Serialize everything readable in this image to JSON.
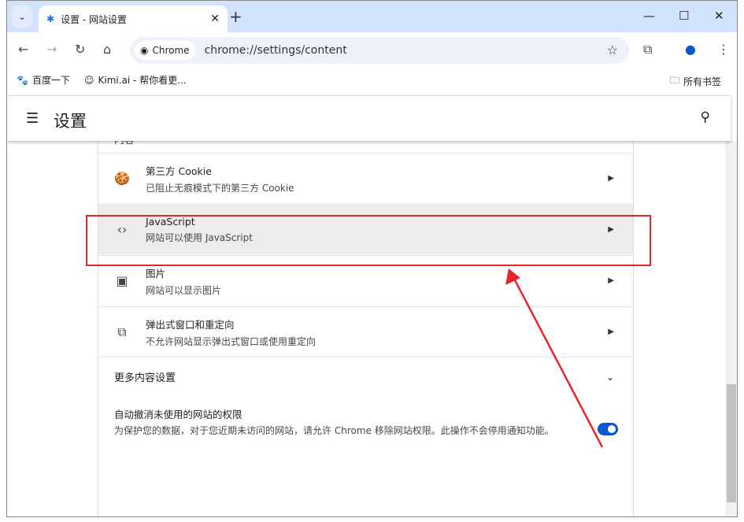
{
  "tab": {
    "title": "设置 - 网站设置",
    "icon": "gear-icon"
  },
  "toolbar": {
    "chip": "Chrome",
    "url": "chrome://settings/content"
  },
  "bookmarks": [
    {
      "label": "百度一下",
      "icon": "baidu-icon"
    },
    {
      "label": "Kimi.ai - 帮你看更...",
      "icon": "kimi-icon"
    }
  ],
  "all_bookmarks": "所有书签",
  "header": {
    "title": "设置"
  },
  "section_label": "内容",
  "rows": [
    {
      "title": "第三方 Cookie",
      "subtitle": "已阻止无痕模式下的第三方 Cookie",
      "icon": "cookie-icon"
    },
    {
      "title": "JavaScript",
      "subtitle": "网站可以使用 JavaScript",
      "icon": "code-icon"
    },
    {
      "title": "图片",
      "subtitle": "网站可以显示图片",
      "icon": "image-icon"
    },
    {
      "title": "弹出式窗口和重定向",
      "subtitle": "不允许网站显示弹出式窗口或使用重定向",
      "icon": "open-in-new-icon"
    }
  ],
  "more": "更多内容设置",
  "auto_revoke": {
    "title": "自动撤消未使用的网站的权限",
    "desc": "为保护您的数据，对于您近期未访问的网站，请允许 Chrome 移除网站权限。此操作不会停用通知功能。",
    "enabled": true
  },
  "colors": {
    "accent": "#0b57d0",
    "annotation": "#e8242b",
    "tabstrip": "#d3e3fd"
  }
}
